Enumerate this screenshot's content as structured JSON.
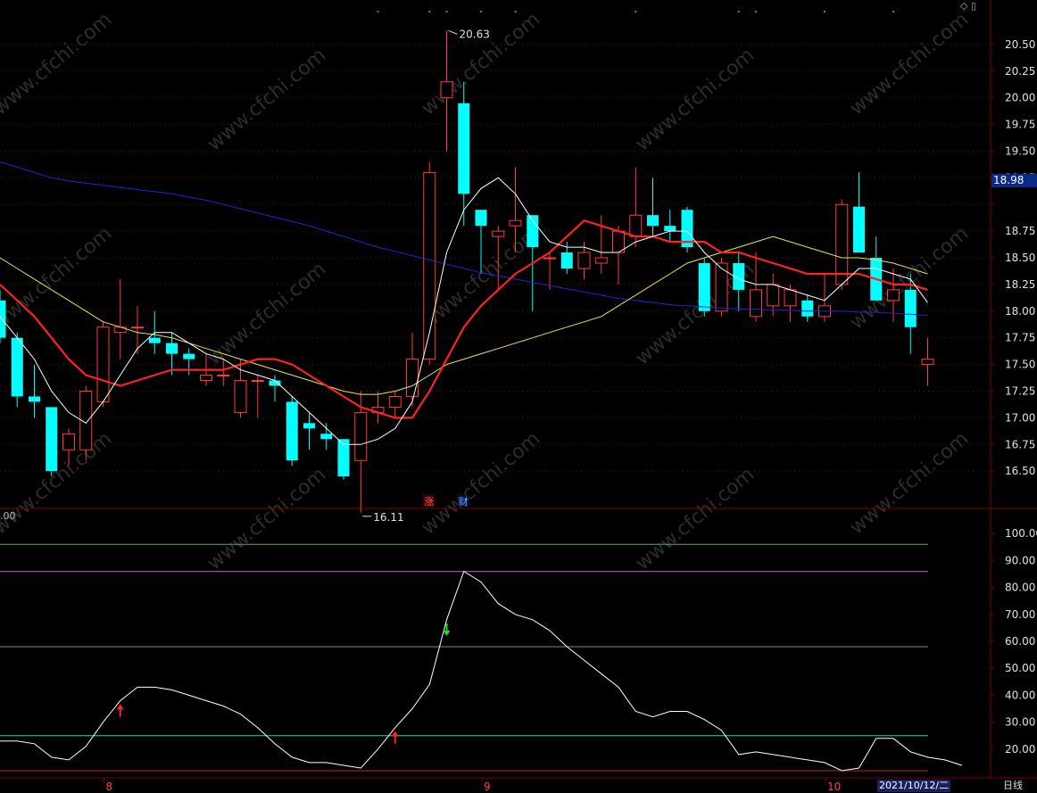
{
  "chart_data": {
    "type": "candlestick",
    "price": {
      "ylim": [
        16.15,
        20.75
      ],
      "y_ticks": [
        16.5,
        16.75,
        17.0,
        17.25,
        17.5,
        17.75,
        18.0,
        18.25,
        18.5,
        18.75,
        19.0,
        19.25,
        19.5,
        19.75,
        20.0,
        20.25,
        20.5
      ],
      "y_tick_labels": [
        "16.50",
        "16.75",
        "17.00",
        "17.25",
        "17.50",
        "17.75",
        "18.00",
        "18.25",
        "18.50",
        "18.75",
        "",
        "19.25",
        "19.50",
        "19.75",
        "20.00",
        "20.25",
        "20.50"
      ],
      "candles": [
        {
          "o": 18.1,
          "h": 18.2,
          "l": 17.7,
          "c": 17.75
        },
        {
          "o": 17.75,
          "h": 17.8,
          "l": 17.1,
          "c": 17.2
        },
        {
          "o": 17.2,
          "h": 17.5,
          "l": 17.0,
          "c": 17.15
        },
        {
          "o": 17.1,
          "h": 17.1,
          "l": 16.45,
          "c": 16.5
        },
        {
          "o": 16.7,
          "h": 16.9,
          "l": 16.55,
          "c": 16.85
        },
        {
          "o": 16.7,
          "h": 17.3,
          "l": 16.6,
          "c": 17.25
        },
        {
          "o": 17.15,
          "h": 17.9,
          "l": 17.1,
          "c": 17.85
        },
        {
          "o": 17.8,
          "h": 18.3,
          "l": 17.55,
          "c": 17.85
        },
        {
          "o": 17.85,
          "h": 18.05,
          "l": 17.6,
          "c": 17.85
        },
        {
          "o": 17.75,
          "h": 18.0,
          "l": 17.6,
          "c": 17.7
        },
        {
          "o": 17.7,
          "h": 17.8,
          "l": 17.4,
          "c": 17.6
        },
        {
          "o": 17.6,
          "h": 17.65,
          "l": 17.4,
          "c": 17.55
        },
        {
          "o": 17.35,
          "h": 17.6,
          "l": 17.3,
          "c": 17.4
        },
        {
          "o": 17.4,
          "h": 17.55,
          "l": 17.3,
          "c": 17.4
        },
        {
          "o": 17.05,
          "h": 17.55,
          "l": 17.0,
          "c": 17.35
        },
        {
          "o": 17.35,
          "h": 17.4,
          "l": 17.0,
          "c": 17.35
        },
        {
          "o": 17.35,
          "h": 17.4,
          "l": 17.15,
          "c": 17.3
        },
        {
          "o": 17.15,
          "h": 17.2,
          "l": 16.55,
          "c": 16.6
        },
        {
          "o": 16.95,
          "h": 17.05,
          "l": 16.7,
          "c": 16.9
        },
        {
          "o": 16.85,
          "h": 16.95,
          "l": 16.7,
          "c": 16.8
        },
        {
          "o": 16.8,
          "h": 16.8,
          "l": 16.42,
          "c": 16.45
        },
        {
          "o": 16.6,
          "h": 17.25,
          "l": 16.11,
          "c": 17.05
        },
        {
          "o": 17.05,
          "h": 17.25,
          "l": 16.95,
          "c": 17.1
        },
        {
          "o": 17.1,
          "h": 17.25,
          "l": 17.0,
          "c": 17.2
        },
        {
          "o": 17.2,
          "h": 17.8,
          "l": 17.1,
          "c": 17.55
        },
        {
          "o": 17.55,
          "h": 19.4,
          "l": 17.5,
          "c": 19.3
        },
        {
          "o": 20.0,
          "h": 20.63,
          "l": 19.5,
          "c": 20.15
        },
        {
          "o": 19.95,
          "h": 20.15,
          "l": 18.8,
          "c": 19.1
        },
        {
          "o": 18.95,
          "h": 18.95,
          "l": 18.35,
          "c": 18.8
        },
        {
          "o": 18.7,
          "h": 18.8,
          "l": 18.2,
          "c": 18.75
        },
        {
          "o": 18.8,
          "h": 19.35,
          "l": 18.55,
          "c": 18.85
        },
        {
          "o": 18.9,
          "h": 18.9,
          "l": 18.0,
          "c": 18.6
        },
        {
          "o": 18.5,
          "h": 18.55,
          "l": 18.2,
          "c": 18.5
        },
        {
          "o": 18.55,
          "h": 18.65,
          "l": 18.35,
          "c": 18.4
        },
        {
          "o": 18.4,
          "h": 18.65,
          "l": 18.3,
          "c": 18.55
        },
        {
          "o": 18.45,
          "h": 18.9,
          "l": 18.35,
          "c": 18.5
        },
        {
          "o": 18.55,
          "h": 18.8,
          "l": 18.25,
          "c": 18.75
        },
        {
          "o": 18.7,
          "h": 19.35,
          "l": 18.6,
          "c": 18.9
        },
        {
          "o": 18.9,
          "h": 19.25,
          "l": 18.7,
          "c": 18.8
        },
        {
          "o": 18.8,
          "h": 18.95,
          "l": 18.65,
          "c": 18.75
        },
        {
          "o": 18.95,
          "h": 18.98,
          "l": 18.55,
          "c": 18.6
        },
        {
          "o": 18.45,
          "h": 18.5,
          "l": 17.95,
          "c": 18.0
        },
        {
          "o": 18.0,
          "h": 18.5,
          "l": 17.95,
          "c": 18.45
        },
        {
          "o": 18.45,
          "h": 18.55,
          "l": 18.0,
          "c": 18.2
        },
        {
          "o": 17.95,
          "h": 18.55,
          "l": 17.9,
          "c": 18.2
        },
        {
          "o": 18.05,
          "h": 18.35,
          "l": 17.95,
          "c": 18.25
        },
        {
          "o": 18.05,
          "h": 18.25,
          "l": 17.9,
          "c": 18.2
        },
        {
          "o": 18.1,
          "h": 18.15,
          "l": 17.9,
          "c": 17.95
        },
        {
          "o": 17.95,
          "h": 18.35,
          "l": 17.9,
          "c": 18.05
        },
        {
          "o": 18.25,
          "h": 19.05,
          "l": 18.2,
          "c": 19.0
        },
        {
          "o": 18.98,
          "h": 19.3,
          "l": 18.55,
          "c": 18.55
        },
        {
          "o": 18.5,
          "h": 18.7,
          "l": 18.1,
          "c": 18.1
        },
        {
          "o": 18.1,
          "h": 18.4,
          "l": 17.9,
          "c": 18.2
        },
        {
          "o": 18.2,
          "h": 18.35,
          "l": 17.6,
          "c": 17.85
        },
        {
          "o": 17.5,
          "h": 17.75,
          "l": 17.3,
          "c": 17.55
        }
      ],
      "ma5": [
        17.95,
        17.75,
        17.55,
        17.25,
        17.05,
        16.95,
        17.15,
        17.4,
        17.65,
        17.8,
        17.8,
        17.7,
        17.6,
        17.55,
        17.45,
        17.4,
        17.35,
        17.2,
        17.05,
        16.9,
        16.75,
        16.75,
        16.8,
        16.9,
        17.15,
        17.8,
        18.55,
        18.95,
        19.15,
        19.25,
        19.1,
        18.85,
        18.65,
        18.6,
        18.6,
        18.55,
        18.55,
        18.65,
        18.7,
        18.75,
        18.75,
        18.55,
        18.4,
        18.3,
        18.25,
        18.25,
        18.2,
        18.15,
        18.1,
        18.25,
        18.4,
        18.4,
        18.35,
        18.3,
        18.08
      ],
      "ma10": [
        18.25,
        18.1,
        17.95,
        17.75,
        17.55,
        17.4,
        17.35,
        17.3,
        17.35,
        17.4,
        17.45,
        17.45,
        17.45,
        17.45,
        17.5,
        17.55,
        17.55,
        17.5,
        17.4,
        17.3,
        17.2,
        17.1,
        17.05,
        17.0,
        17.0,
        17.25,
        17.55,
        17.85,
        18.05,
        18.2,
        18.35,
        18.45,
        18.55,
        18.7,
        18.85,
        18.8,
        18.75,
        18.7,
        18.7,
        18.65,
        18.65,
        18.65,
        18.55,
        18.55,
        18.5,
        18.45,
        18.4,
        18.35,
        18.35,
        18.35,
        18.35,
        18.3,
        18.25,
        18.25,
        18.2
      ],
      "ma20": [
        18.5,
        18.4,
        18.3,
        18.2,
        18.1,
        18.0,
        17.9,
        17.85,
        17.8,
        17.78,
        17.75,
        17.7,
        17.65,
        17.6,
        17.55,
        17.5,
        17.45,
        17.4,
        17.35,
        17.3,
        17.25,
        17.22,
        17.22,
        17.25,
        17.3,
        17.4,
        17.5,
        17.55,
        17.6,
        17.65,
        17.7,
        17.75,
        17.8,
        17.85,
        17.9,
        17.95,
        18.05,
        18.15,
        18.25,
        18.35,
        18.45,
        18.5,
        18.55,
        18.6,
        18.65,
        18.7,
        18.65,
        18.6,
        18.55,
        18.5,
        18.5,
        18.48,
        18.45,
        18.4,
        18.35
      ],
      "ma60": [
        19.4,
        19.35,
        19.3,
        19.25,
        19.22,
        19.2,
        19.18,
        19.16,
        19.14,
        19.12,
        19.1,
        19.07,
        19.04,
        19.0,
        18.96,
        18.92,
        18.88,
        18.84,
        18.8,
        18.75,
        18.7,
        18.65,
        18.6,
        18.56,
        18.52,
        18.48,
        18.44,
        18.4,
        18.36,
        18.33,
        18.3,
        18.27,
        18.24,
        18.21,
        18.18,
        18.15,
        18.12,
        18.1,
        18.08,
        18.06,
        18.05,
        18.04,
        18.03,
        18.02,
        18.02,
        18.01,
        18.01,
        18.0,
        18.0,
        18.0,
        17.99,
        17.99,
        17.98,
        17.97,
        17.96
      ],
      "annotations": {
        "high": "20.63",
        "low": "16.11"
      },
      "current_price": "18.98",
      "event_tags": [
        "涨",
        "财"
      ]
    },
    "indicator": {
      "ylim": [
        12,
        108
      ],
      "y_ticks": [
        20,
        30,
        40,
        50,
        60,
        70,
        80,
        90,
        100
      ],
      "y_tick_labels": [
        "20.00",
        "30.00",
        "40.00",
        "50.00",
        "60.00",
        "70.00",
        "80.00",
        "90.00",
        "100.00"
      ],
      "left_label": ".00",
      "ref_lines": [
        {
          "value": 96,
          "color": "#4caf50"
        },
        {
          "value": 86,
          "color": "#cc33cc"
        },
        {
          "value": 58,
          "color": "#888888"
        },
        {
          "value": 25,
          "color": "#33cccc"
        },
        {
          "value": 12,
          "color": "#cc2222"
        }
      ],
      "values": [
        23,
        23,
        22,
        17,
        16,
        21,
        30,
        38,
        43,
        43,
        42,
        40,
        38,
        36,
        33,
        28,
        22,
        17,
        15,
        15,
        14,
        13,
        20,
        28,
        35,
        44,
        68,
        86,
        82,
        74,
        70,
        68,
        64,
        58,
        53,
        48,
        43,
        34,
        32,
        34,
        34,
        31,
        27,
        18,
        19,
        18,
        17,
        16,
        15,
        12,
        13,
        24,
        24,
        19,
        17,
        16,
        14
      ],
      "up_arrows_at": [
        7,
        23
      ],
      "down_arrows_at": [
        26
      ]
    },
    "x_labels": [
      {
        "label": "8",
        "index": 6
      },
      {
        "label": "9",
        "index": 28
      },
      {
        "label": "10",
        "index": 48
      }
    ],
    "date": "2021/10/12/二",
    "period": "日线",
    "colors": {
      "up": "#ff3b3b",
      "down": "#00ffff",
      "ma5": "#ffffff",
      "ma10": "#ff2222",
      "ma20": "#e6e64c",
      "ma60": "#2222dd",
      "grid": "#800000",
      "axis": "#800000"
    }
  },
  "watermark": "www.cfchi.com"
}
